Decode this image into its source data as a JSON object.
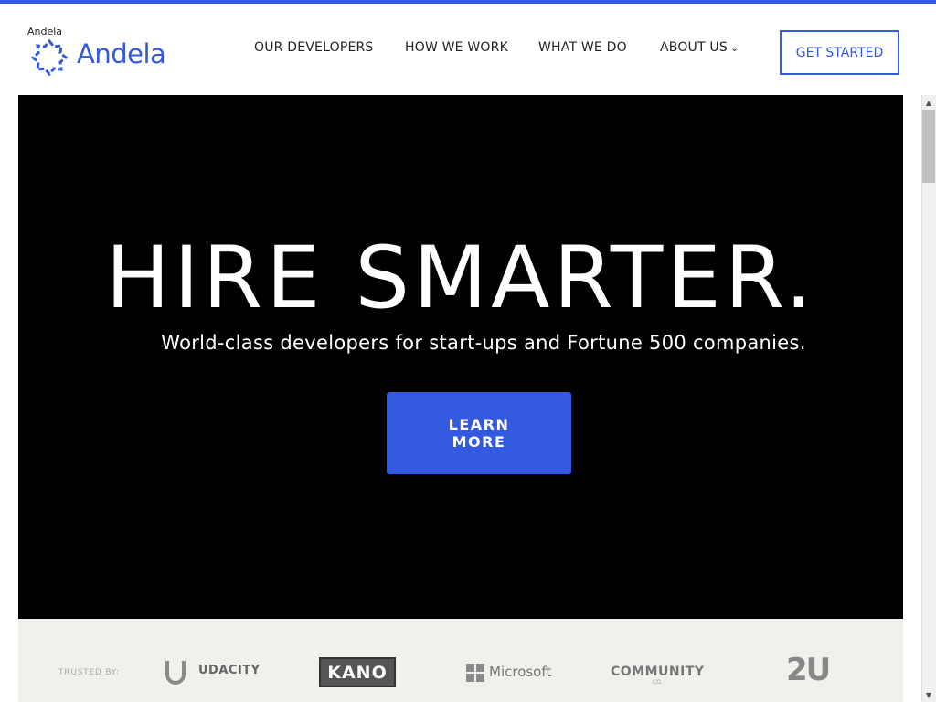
{
  "brand": {
    "small_label": "Andela",
    "name": "Andela",
    "accent_color": "#3359df"
  },
  "nav": {
    "items": [
      {
        "label": "OUR DEVELOPERS"
      },
      {
        "label": "HOW WE WORK"
      },
      {
        "label": "WHAT WE DO"
      },
      {
        "label": "ABOUT US",
        "icon": "chevron-down-icon"
      }
    ],
    "cta": "GET STARTED"
  },
  "hero": {
    "title": "HIRE SMARTER.",
    "subtitle": "World-class developers for start-ups and Fortune 500 companies.",
    "button_line1": "LEARN",
    "button_line2": "MORE"
  },
  "trusted": {
    "label": "TRUSTED BY:",
    "logos": [
      {
        "name": "UDACITY",
        "icon": "udacity-logo"
      },
      {
        "name": "KANO",
        "icon": "kano-logo"
      },
      {
        "name": "Microsoft",
        "icon": "microsoft-logo"
      },
      {
        "name": "COMMUNITY",
        "sub": "CO.",
        "icon": "community-logo"
      },
      {
        "name": "2U",
        "icon": "2u-logo"
      }
    ]
  }
}
